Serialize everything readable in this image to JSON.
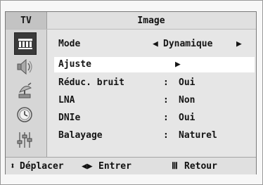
{
  "header": {
    "tv_label": "TV",
    "title": "Image"
  },
  "sidebar": {
    "icons": [
      "picture-icon",
      "sound-icon",
      "channel-icon",
      "clock-icon",
      "setup-icon"
    ],
    "active_index": 0
  },
  "menu": {
    "items": [
      {
        "label": "Mode",
        "value": "Dynamique",
        "type": "choice"
      },
      {
        "label": "Ajuste",
        "value": "",
        "type": "submenu",
        "selected": true
      },
      {
        "label": "Réduc. bruit",
        "colon": ":",
        "value": "Oui",
        "type": "value"
      },
      {
        "label": "LNA",
        "colon": ":",
        "value": "Non",
        "type": "value"
      },
      {
        "label": "DNIe",
        "colon": ":",
        "value": "Oui",
        "type": "value"
      },
      {
        "label": "Balayage",
        "colon": ":",
        "value": "Naturel",
        "type": "value"
      }
    ]
  },
  "footer": {
    "move_label": "Déplacer",
    "enter_label": "Entrer",
    "return_label": "Retour"
  }
}
